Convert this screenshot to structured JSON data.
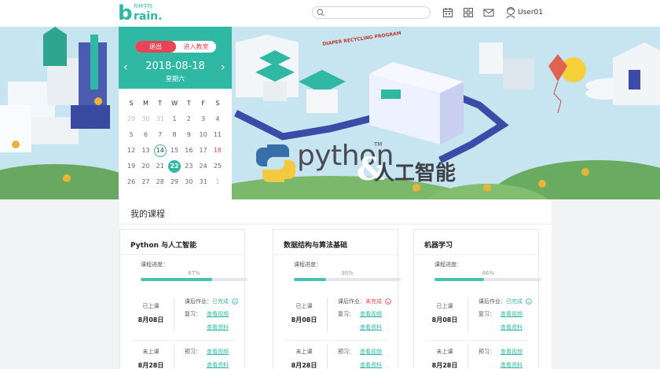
{
  "header": {
    "logo_letter": "b",
    "logo_word": "rain.",
    "logo_sub": "布林学院",
    "search_placeholder": "",
    "username": "User01",
    "icons": [
      "calendar-icon",
      "grid-icon",
      "mail-icon",
      "user-avatar-icon",
      "search-icon"
    ]
  },
  "banner": {
    "headline_python": "python",
    "headline_tm": "TM",
    "headline_amp": "&",
    "headline_ai": "人工智能",
    "sign_text": "DIAPER RECYCLING PROGRAM"
  },
  "calendar": {
    "exit_label": "退出",
    "enter_label": "进入教室",
    "date": "2018-08-18",
    "weekday": "星期六",
    "prev": "‹",
    "next": "›",
    "weekday_headers": [
      "S",
      "M",
      "T",
      "W",
      "T",
      "F",
      "S"
    ],
    "weeks": [
      [
        "29",
        "30",
        "31",
        "1",
        "2",
        "3",
        "4"
      ],
      [
        "5",
        "6",
        "7",
        "8",
        "9",
        "10",
        "11"
      ],
      [
        "12",
        "13",
        "14",
        "15",
        "16",
        "17",
        "18"
      ],
      [
        "19",
        "20",
        "21",
        "22",
        "23",
        "24",
        "25"
      ],
      [
        "26",
        "27",
        "28",
        "29",
        "30",
        "31",
        "1"
      ]
    ],
    "today": "14",
    "selected": "22",
    "highlight": "18",
    "accent": "#2fb9a5",
    "alert": "#e84457"
  },
  "courses": {
    "section_title": "我的课程",
    "progress_label": "课程进度：",
    "items": [
      {
        "title": "Python 与人工智能",
        "progress_text": "67%",
        "progress": 0.67,
        "sessions": [
          {
            "status": "已上课",
            "date": "8月08日",
            "hw_label": "课后作业：",
            "hw_state": "已完成",
            "hw_done": true,
            "review_label": "复习：",
            "link1": "查看视频",
            "link2": "查看资料"
          },
          {
            "status": "未上课",
            "date": "8月28日",
            "review_label": "预习：",
            "link1": "查看视频",
            "link2": "查看资料"
          }
        ]
      },
      {
        "title": "数据结构与算法基础",
        "progress_text": "30%",
        "progress": 0.3,
        "sessions": [
          {
            "status": "已上课",
            "date": "8月08日",
            "hw_label": "课后作业：",
            "hw_state": "未完成",
            "hw_done": false,
            "review_label": "复习：",
            "link1": "查看视频",
            "link2": "查看资料"
          },
          {
            "status": "未上课",
            "date": "8月28日",
            "review_label": "预习：",
            "link1": "查看视频",
            "link2": "查看资料"
          }
        ]
      },
      {
        "title": "机器学习",
        "progress_text": "46%",
        "progress": 0.46,
        "sessions": [
          {
            "status": "已上课",
            "date": "8月08日",
            "hw_label": "课后作业：",
            "hw_state": "已完成",
            "hw_done": true,
            "review_label": "复习：",
            "link1": "查看视频",
            "link2": "查看资料"
          },
          {
            "status": "未上课",
            "date": "8月28日",
            "review_label": "预习：",
            "link1": "查看视频",
            "link2": "查看资料"
          }
        ]
      }
    ]
  }
}
